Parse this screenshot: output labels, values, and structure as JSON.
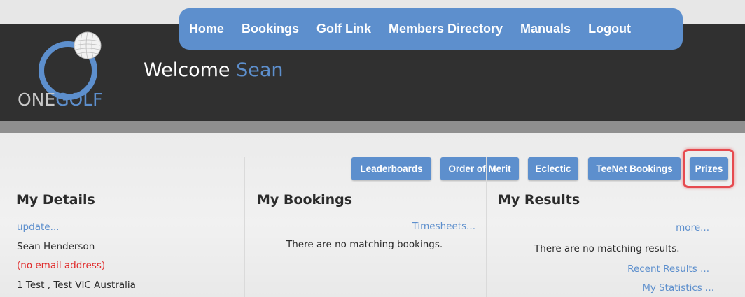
{
  "nav": {
    "items": [
      {
        "label": "Home"
      },
      {
        "label": "Bookings"
      },
      {
        "label": "Golf Link"
      },
      {
        "label": "Members Directory"
      },
      {
        "label": "Manuals"
      },
      {
        "label": "Logout"
      }
    ]
  },
  "logo": {
    "text_one": "ONE",
    "text_golf": "GOLF",
    "icon": "golf-ball-ring-icon"
  },
  "welcome": {
    "prefix": "Welcome",
    "name": "Sean"
  },
  "toolbar": {
    "buttons": [
      {
        "label": "Leaderboards"
      },
      {
        "label": "Order of Merit"
      },
      {
        "label": "Eclectic"
      },
      {
        "label": "TeeNet Bookings"
      },
      {
        "label": "Prizes",
        "highlighted": true
      }
    ]
  },
  "my_details": {
    "title": "My Details",
    "update_link": "update...",
    "name": "Sean Henderson",
    "email": "(no email address)",
    "address": "1 Test , Test VIC Australia"
  },
  "my_bookings": {
    "title": "My Bookings",
    "timesheets_link": "Timesheets...",
    "empty_message": "There are no matching bookings."
  },
  "my_results": {
    "title": "My Results",
    "more_link": "more...",
    "empty_message": "There are no matching results.",
    "recent_results_link": "Recent Results ...",
    "my_statistics_link": "My Statistics ..."
  },
  "colors": {
    "accent": "#5d8fcd",
    "header_bg": "#303030",
    "highlight": "#e64a4f",
    "error_text": "#e02b2b"
  }
}
